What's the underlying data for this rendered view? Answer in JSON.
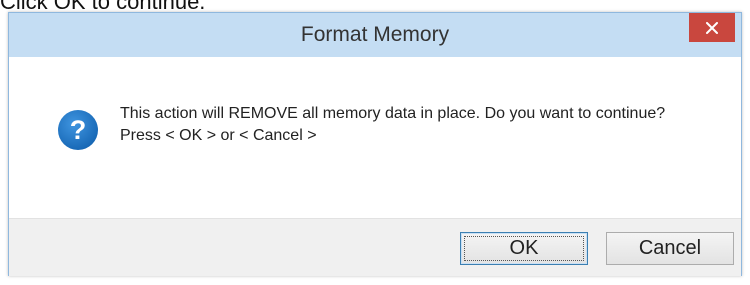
{
  "page": {
    "caption": "Click OK to continue."
  },
  "dialog": {
    "title": "Format Memory",
    "close_icon": "close-icon",
    "icon": "question-icon",
    "icon_color": "#1f76c6",
    "message_line1": "This action will REMOVE all memory data in place. Do you want to continue?",
    "message_line2": "Press < OK > or < Cancel >",
    "buttons": {
      "ok_label": "OK",
      "cancel_label": "Cancel"
    },
    "colors": {
      "titlebar": "#c4ddf3",
      "close_button": "#c9473e"
    }
  }
}
